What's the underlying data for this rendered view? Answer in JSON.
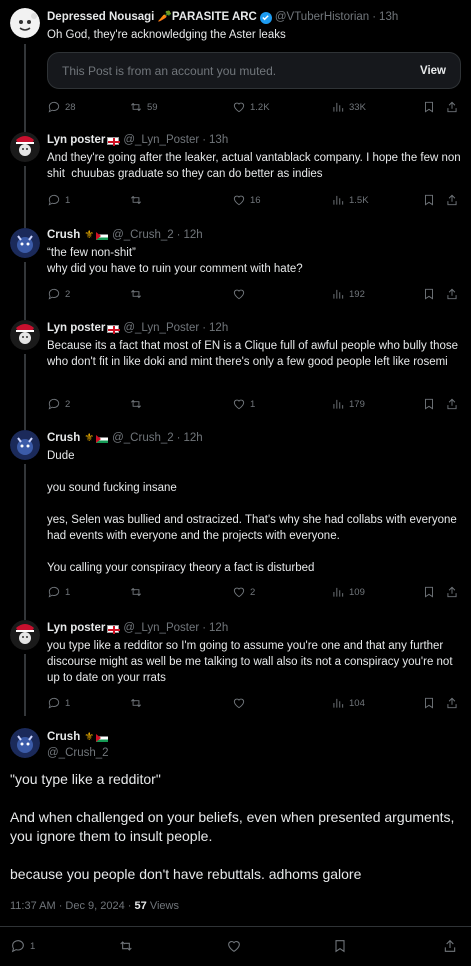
{
  "tweets": [
    {
      "name": "Depressed Nousagi 🥕PARASITE ARC",
      "handle": "@VTuberHistorian",
      "time": "13h",
      "text": "Oh God, they're acknowledging the Aster leaks",
      "muted_notice": "This Post is from an account you muted.",
      "view_label": "View",
      "replies": "28",
      "reposts": "59",
      "likes": "1.2K",
      "views": "33K"
    },
    {
      "name": "Lyn poster",
      "handle": "@_Lyn_Poster",
      "time": "13h",
      "text": "And they're going after the leaker, actual vantablack company. I hope the few non shit  chuubas graduate so they can do better as indies",
      "replies": "1",
      "reposts": "",
      "likes": "16",
      "views": "1.5K"
    },
    {
      "name": "Crush",
      "handle": "@_Crush_2",
      "time": "12h",
      "text": "“the few non-shit”\nwhy did you have to ruin your comment with hate?",
      "replies": "2",
      "reposts": "",
      "likes": "",
      "views": "192"
    },
    {
      "name": "Lyn poster",
      "handle": "@_Lyn_Poster",
      "time": "12h",
      "text": "Because its a fact that most of EN is a Clique full of awful people who bully those who don't fit in like doki and mint there's only a few good people left like rosemi",
      "replies": "2",
      "reposts": "",
      "likes": "1",
      "views": "179"
    },
    {
      "name": "Crush",
      "handle": "@_Crush_2",
      "time": "12h",
      "text": "Dude\n\nyou sound fucking insane\n\nyes, Selen was bullied and ostracized. That's why she had collabs with everyone had events with everyone and the projects with everyone.\n\nYou calling your conspiracy theory a fact is disturbed",
      "replies": "1",
      "reposts": "",
      "likes": "2",
      "views": "109"
    },
    {
      "name": "Lyn poster",
      "handle": "@_Lyn_Poster",
      "time": "12h",
      "text": "you type like a redditor so I'm going to assume you're one and that any further discourse might as well be me talking to wall also its not a conspiracy you're not up to date on your rrats",
      "replies": "1",
      "reposts": "",
      "likes": "",
      "views": "104"
    }
  ],
  "main": {
    "name": "Crush",
    "handle": "@_Crush_2",
    "text": "\"you type like a redditor\"\n\nAnd when challenged on your beliefs, even when presented arguments, you ignore them to insult people.\n\nbecause you people don't have rebuttals. adhoms galore",
    "timestamp": "11:37 AM · Dec 9, 2024 · ",
    "views_count": "57",
    "views_label": " Views",
    "replies": "1"
  },
  "colors": {
    "background": "#000000",
    "text": "#e7e9ea",
    "muted": "#71767b",
    "verified": "#1d9bf0",
    "border": "#2f3336"
  }
}
